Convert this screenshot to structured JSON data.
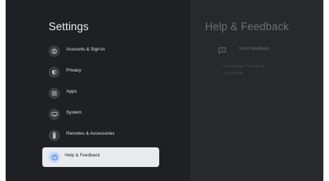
{
  "settings": {
    "title": "Settings",
    "items": [
      {
        "label": "Accounts & Sign-in",
        "icon": "account-icon"
      },
      {
        "label": "Privacy",
        "icon": "shield-icon"
      },
      {
        "label": "Apps",
        "icon": "apps-grid-icon"
      },
      {
        "label": "System",
        "icon": "monitor-icon"
      },
      {
        "label": "Remotes & Accessories",
        "icon": "remote-icon"
      },
      {
        "label": "Help & Feedback",
        "icon": "help-icon",
        "selected": true
      }
    ]
  },
  "detail": {
    "title": "Help & Feedback",
    "send_feedback_label": "Send feedback",
    "help_line1": "Visit Google TV Help at",
    "help_line2": "g.co/tv/help"
  },
  "colors": {
    "background": "#1f2023",
    "detail_background": "#28292c",
    "selected_background": "#e8eaed",
    "selected_icon_background": "#c4d7f5"
  }
}
